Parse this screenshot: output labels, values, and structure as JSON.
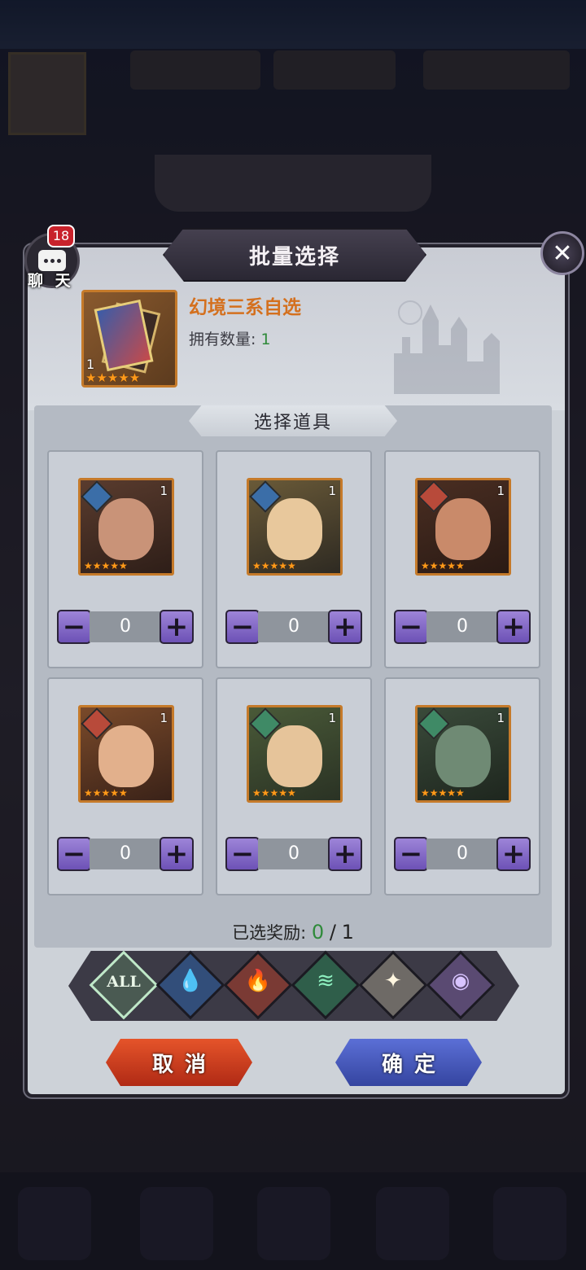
{
  "colors": {
    "accent_orange": "#d4701e",
    "green_value": "#2f8a3a",
    "stepper_purple": "#7d62c6",
    "cancel_red": "#c83a1c",
    "confirm_blue": "#4656b8"
  },
  "chat": {
    "badge": "18",
    "label": "聊 天"
  },
  "dialog": {
    "title": "批量选择",
    "close_icon": "close-icon"
  },
  "item": {
    "name": "幻境三系自选",
    "owned_label": "拥有数量:",
    "owned_value": "1",
    "count": "1",
    "stars": "★★★★★"
  },
  "section_title": "选择道具",
  "heroes": [
    {
      "count": "1",
      "stars": "★★★★★",
      "element": "water",
      "quantity": "0"
    },
    {
      "count": "1",
      "stars": "★★★★★",
      "element": "water",
      "quantity": "0"
    },
    {
      "count": "1",
      "stars": "★★★★★",
      "element": "fire",
      "quantity": "0"
    },
    {
      "count": "1",
      "stars": "★★★★★",
      "element": "fire",
      "quantity": "0"
    },
    {
      "count": "1",
      "stars": "★★★★★",
      "element": "wind",
      "quantity": "0"
    },
    {
      "count": "1",
      "stars": "★★★★★",
      "element": "wind",
      "quantity": "0"
    }
  ],
  "stepper": {
    "minus": "−",
    "plus": "+"
  },
  "selected": {
    "label": "已选奖励:",
    "current": "0",
    "separator": "/",
    "total": "1"
  },
  "filters": {
    "all_label": "ALL",
    "water": "💧",
    "fire": "🔥",
    "wind": "≋",
    "light": "✦",
    "dark": "◉"
  },
  "buttons": {
    "cancel": "取消",
    "confirm": "确定"
  }
}
